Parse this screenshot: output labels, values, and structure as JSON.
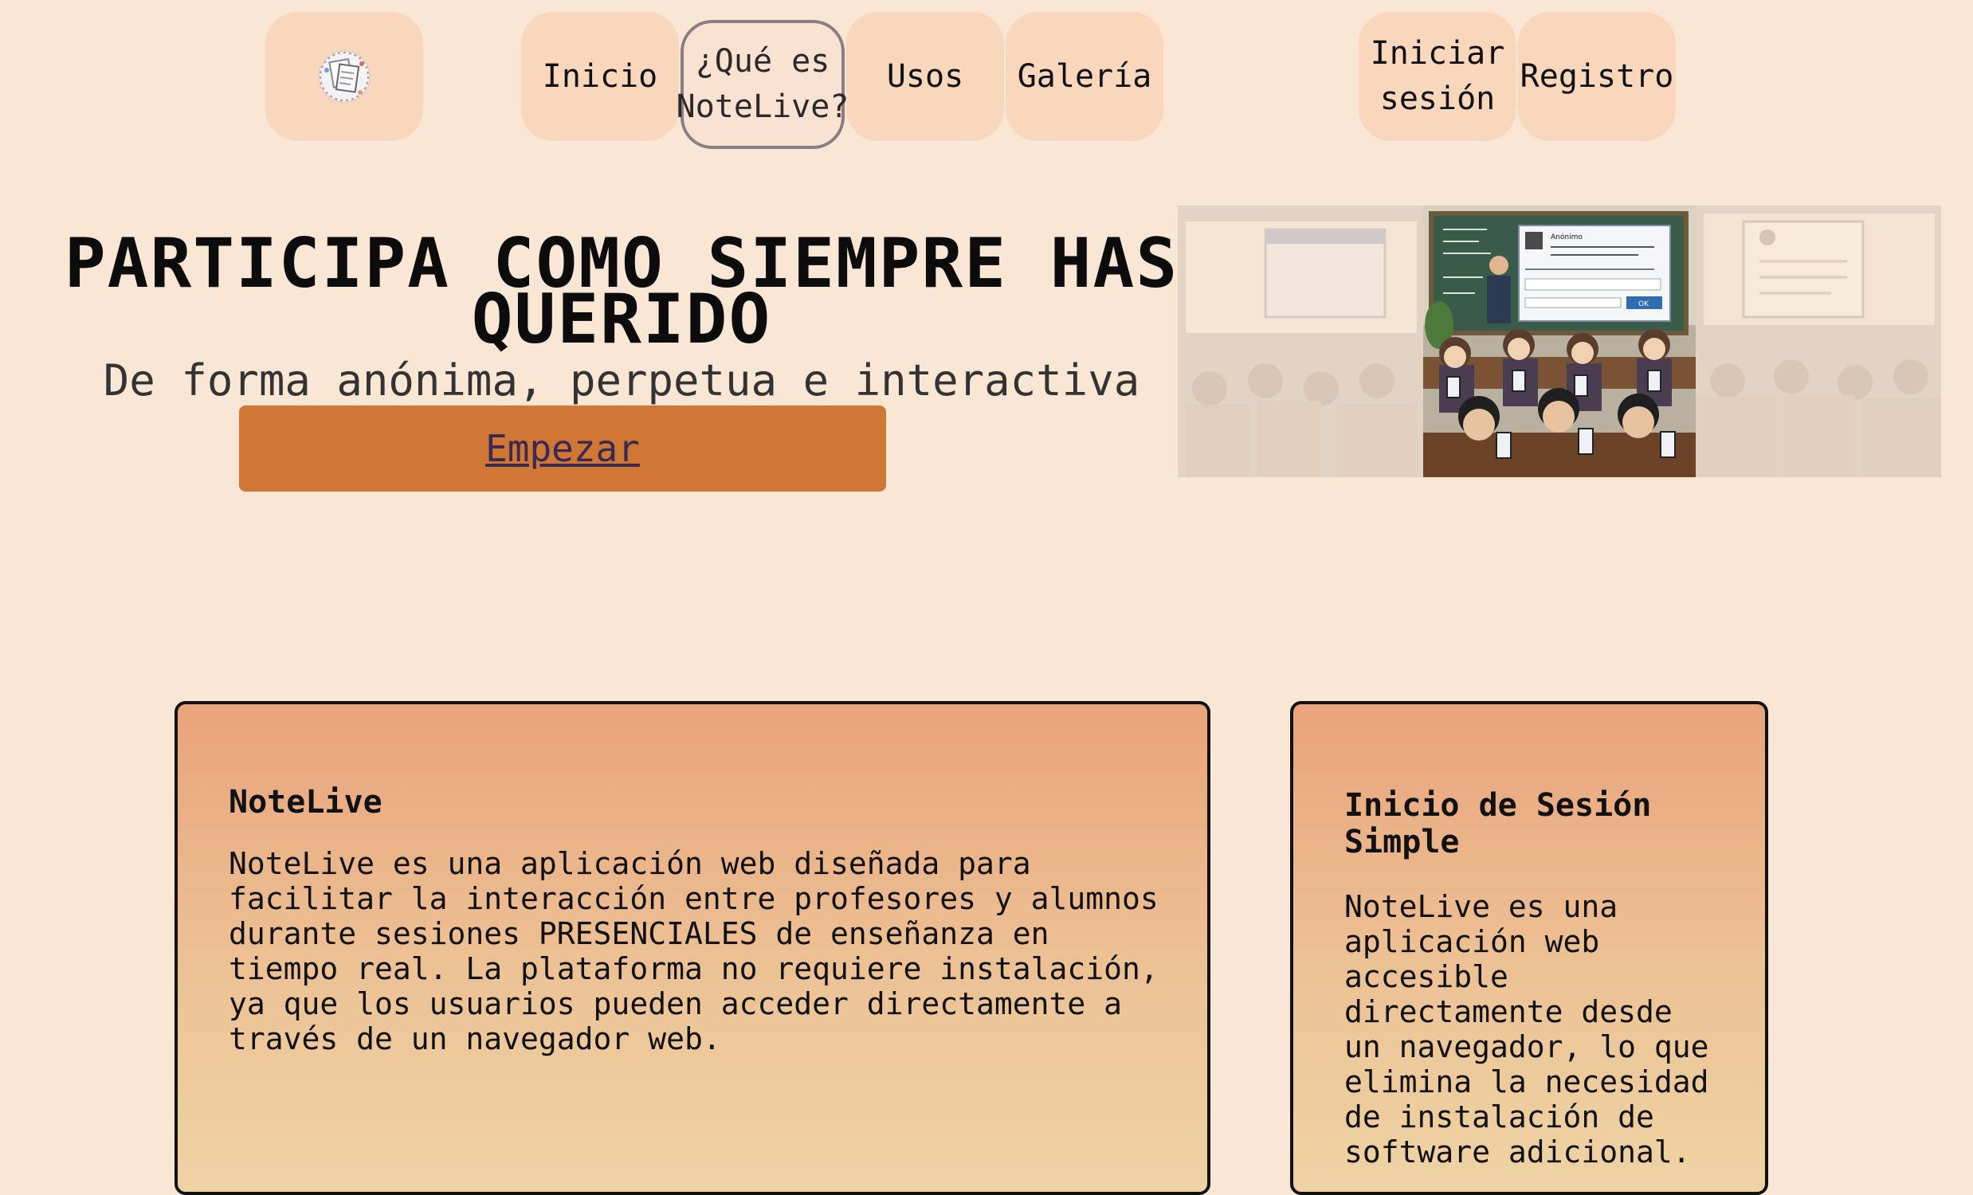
{
  "nav": {
    "logo_alt": "NoteLive logo",
    "items": [
      {
        "label": "Inicio"
      },
      {
        "label": "¿Qué es\nNoteLive?"
      },
      {
        "label": "Usos"
      },
      {
        "label": "Galería"
      }
    ],
    "login_label": "Iniciar\nsesión",
    "register_label": "Registro"
  },
  "hero": {
    "title": "PARTICIPA COMO SIEMPRE HAS QUERIDO",
    "subtitle": "De forma anónima, perpetua e interactiva",
    "cta_label": "Empezar"
  },
  "carousel": {
    "popup_title": "Anónimo",
    "popup_button": "OK"
  },
  "cards": [
    {
      "title": "NoteLive",
      "text": "NoteLive es una aplicación web diseñada para\nfacilitar la interacción entre profesores y alumnos\ndurante sesiones PRESENCIALES de enseñanza en\ntiempo real. La plataforma no requiere instalación,\nya que los usuarios pueden acceder directamente a\ntravés de un navegador web."
    },
    {
      "title": "Inicio de Sesión\nSimple",
      "text": "NoteLive es una\naplicación web\naccesible\ndirectamente desde\nun navegador, lo que\nelimina la necesidad\nde instalación de\nsoftware adicional."
    }
  ],
  "colors": {
    "background": "#f9e6d5",
    "nav_button": "#f8d7bd",
    "cta": "#d07736",
    "card_top": "#e9a37b",
    "card_bottom": "#eed3a4"
  }
}
